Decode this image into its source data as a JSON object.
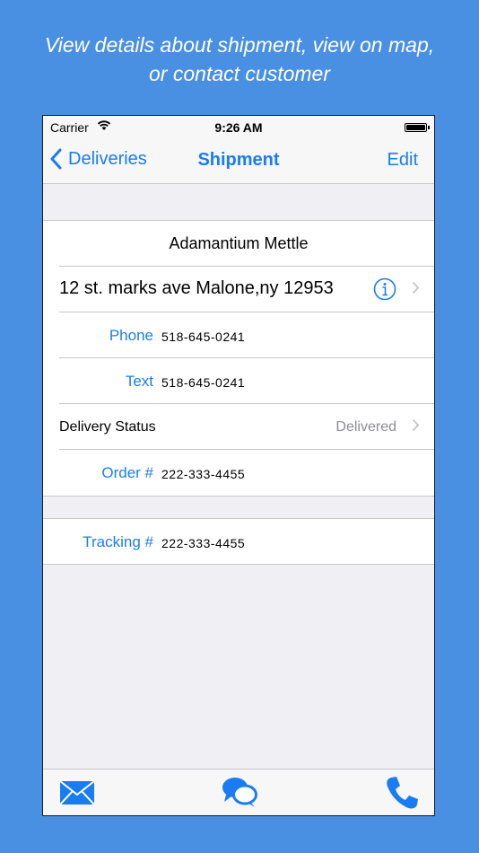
{
  "caption": {
    "line1": "View details about shipment, view on map,",
    "line2": "or contact customer"
  },
  "status_bar": {
    "carrier": "Carrier",
    "time": "9:26 AM",
    "icons": [
      "wifi-icon",
      "battery-icon"
    ]
  },
  "nav": {
    "back_label": "Deliveries",
    "title": "Shipment",
    "edit_label": "Edit"
  },
  "details": {
    "customer_name": "Adamantium Mettle",
    "address": "12 st. marks ave Malone,ny 12953",
    "phone_label": "Phone",
    "phone_value": "518-645-0241",
    "text_label": "Text",
    "text_value": "518-645-0241",
    "delivery_status_label": "Delivery Status",
    "delivery_status_value": "Delivered",
    "order_label": "Order #",
    "order_value": "222-333-4455"
  },
  "tracking": {
    "label": "Tracking #",
    "value": "222-333-4455"
  },
  "tabbar": {
    "icons": [
      "mail-icon",
      "chat-icon",
      "phone-icon"
    ]
  },
  "colors": {
    "background": "#4a90e2",
    "accent": "#1a7cf2",
    "secondary_text": "#8e8e93"
  }
}
